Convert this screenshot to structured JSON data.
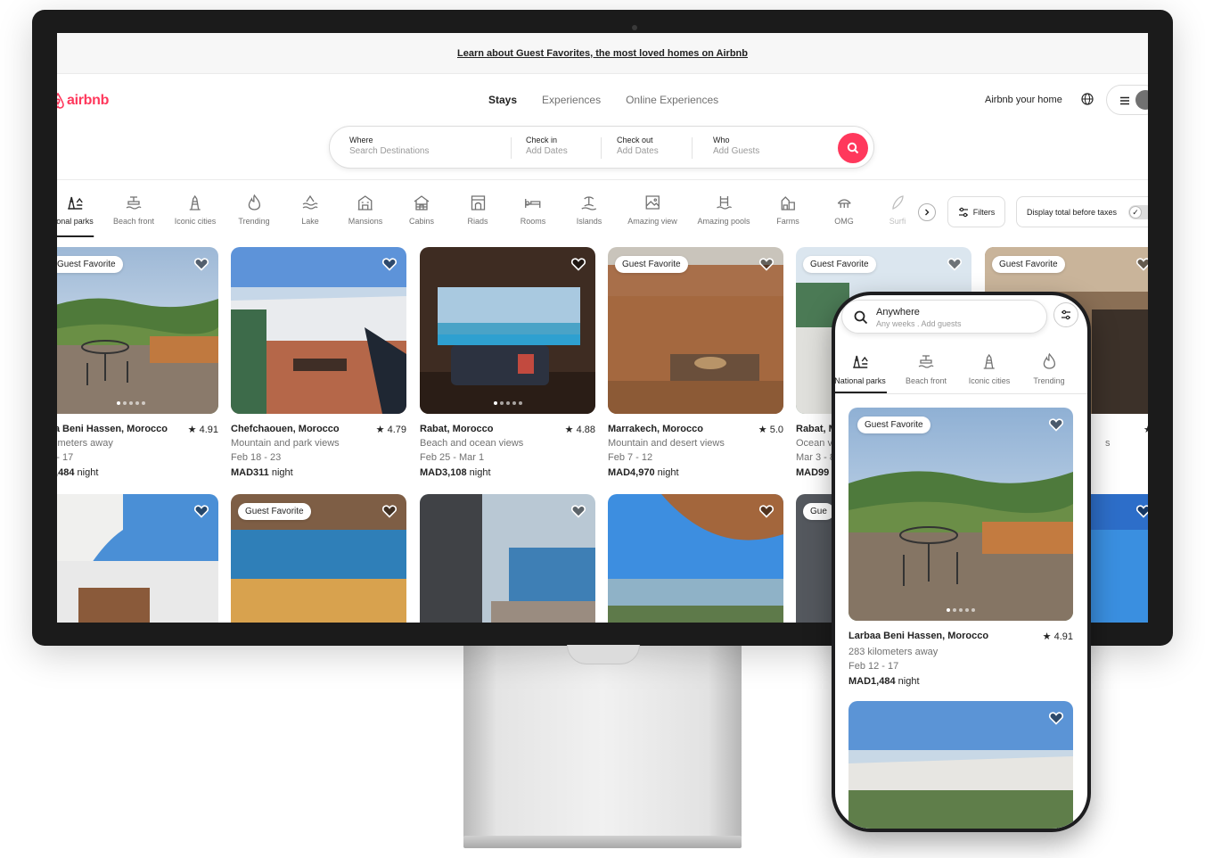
{
  "banner": {
    "text": "Learn about Guest Favorites, the most loved homes on Airbnb"
  },
  "brand": {
    "name": "airbnb",
    "color": "#FF385C"
  },
  "nav": {
    "tabs": [
      "Stays",
      "Experiences",
      "Online Experiences"
    ],
    "host_link": "Airbnb your home",
    "icons": [
      "globe-icon",
      "hamburger-icon",
      "user-avatar-icon"
    ]
  },
  "search": {
    "where_label": "Where",
    "where_placeholder": "Search Destinations",
    "checkin_label": "Check in",
    "checkin_placeholder": "Add Dates",
    "checkout_label": "Check out",
    "checkout_placeholder": "Add Dates",
    "who_label": "Who",
    "who_placeholder": "Add Guests"
  },
  "categories": [
    {
      "label": "onal parks",
      "icon": "national-parks-icon"
    },
    {
      "label": "Beach front",
      "icon": "beach-front-icon"
    },
    {
      "label": "Iconic cities",
      "icon": "iconic-cities-icon"
    },
    {
      "label": "Trending",
      "icon": "trending-icon"
    },
    {
      "label": "Lake",
      "icon": "lake-icon"
    },
    {
      "label": "Mansions",
      "icon": "mansions-icon"
    },
    {
      "label": "Cabins",
      "icon": "cabins-icon"
    },
    {
      "label": "Riads",
      "icon": "riads-icon"
    },
    {
      "label": "Rooms",
      "icon": "rooms-icon"
    },
    {
      "label": "Islands",
      "icon": "islands-icon"
    },
    {
      "label": "Amazing view",
      "icon": "amazing-view-icon"
    },
    {
      "label": "Amazing pools",
      "icon": "amazing-pools-icon"
    },
    {
      "label": "Farms",
      "icon": "farms-icon"
    },
    {
      "label": "OMG",
      "icon": "omg-icon"
    },
    {
      "label": "Surfi",
      "icon": "surfing-icon"
    }
  ],
  "filters": {
    "label": "Filters",
    "taxes_label": "Display total before taxes",
    "taxes_check": "✓"
  },
  "listings": [
    {
      "title": "baa Beni Hassen, Morocco",
      "rating": "★ 4.91",
      "line1": "kilometers away",
      "line2": "12 - 17",
      "price": "D1,484",
      "unit": "night",
      "badge": "Guest Favorite"
    },
    {
      "title": "Chefchaouen, Morocco",
      "rating": "★ 4.79",
      "line1": "Mountain and park views",
      "line2": "Feb 18 - 23",
      "price": "MAD311",
      "unit": "night",
      "badge": ""
    },
    {
      "title": "Rabat, Morocco",
      "rating": "★ 4.88",
      "line1": "Beach and ocean views",
      "line2": "Feb 25 - Mar 1",
      "price": "MAD3,108",
      "unit": "night",
      "badge": ""
    },
    {
      "title": "Marrakech, Morocco",
      "rating": "★ 5.0",
      "line1": "Mountain and desert views",
      "line2": "Feb 7 - 12",
      "price": "MAD4,970",
      "unit": "night",
      "badge": "Guest Favorite"
    },
    {
      "title": "Rabat, M",
      "rating": "",
      "line1": "Ocean v",
      "line2": "Mar 3 - 8",
      "price": "MAD99",
      "unit": "",
      "badge": "Guest Favorite"
    },
    {
      "title": "",
      "rating": "★ 4",
      "line1": "s",
      "line2": "",
      "price": "",
      "unit": "",
      "badge": "Guest Favorite"
    }
  ],
  "second_row_badges": [
    "",
    "Guest Favorite",
    "",
    "",
    "Gue",
    ""
  ],
  "phone": {
    "search_title": "Anywhere",
    "search_sub": "Any weeks . Add guests",
    "categories": [
      "National parks",
      "Beach front",
      "Iconic cities",
      "Trending"
    ],
    "listing": {
      "badge": "Guest Favorite",
      "title": "Larbaa Beni Hassen, Morocco",
      "rating": "★ 4.91",
      "line1": "283 kilometers away",
      "line2": "Feb 12 - 17",
      "price": "MAD1,484",
      "unit": "night"
    }
  }
}
